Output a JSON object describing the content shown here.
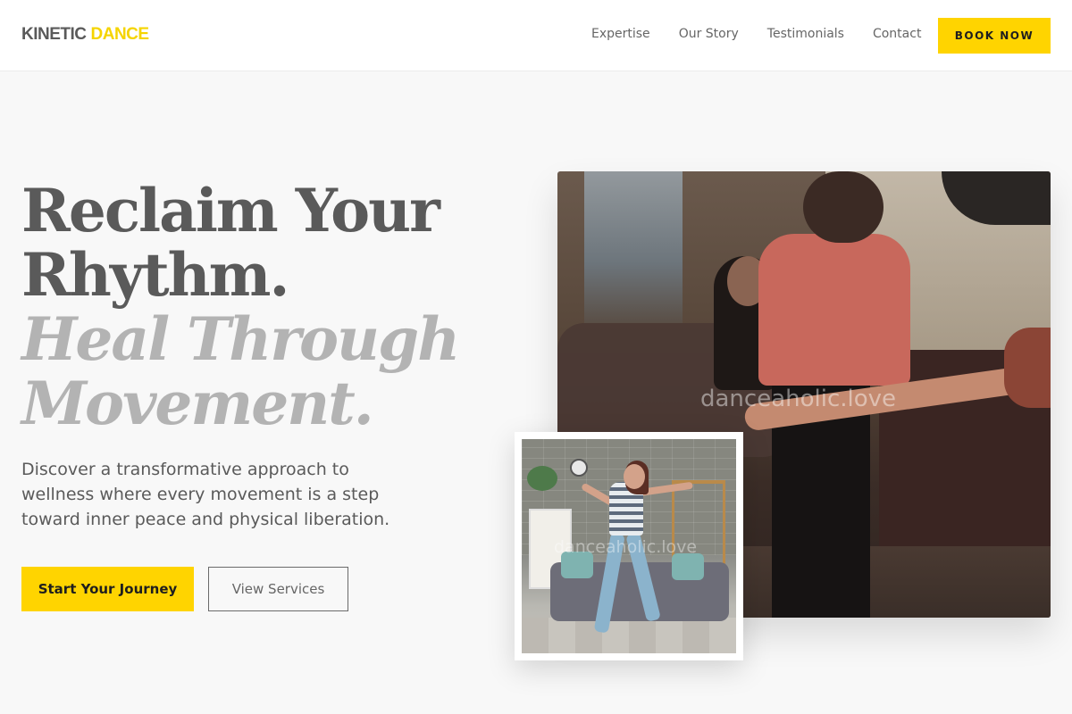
{
  "header": {
    "logo": {
      "word1": "KINETIC",
      "word2": "DANCE"
    },
    "nav": [
      {
        "label": "Expertise"
      },
      {
        "label": "Our Story"
      },
      {
        "label": "Testimonials"
      },
      {
        "label": "Contact"
      }
    ],
    "cta": "BOOK NOW"
  },
  "hero": {
    "headline_line1": "Reclaim Your",
    "headline_line2": "Rhythm.",
    "headline_line3": "Heal Through",
    "headline_line4": "Movement.",
    "description": "Discover a transformative approach to wellness where every movement is a step toward inner peace and physical liberation.",
    "primary_button": "Start Your Journey",
    "secondary_button": "View Services"
  },
  "images": {
    "large_watermark": "danceaholic.love",
    "small_watermark": "danceaholic.love"
  },
  "colors": {
    "accent": "#ffd400",
    "text": "#5a5a5a",
    "headline_muted": "#b3b3b3",
    "background": "#f8f8f8"
  }
}
